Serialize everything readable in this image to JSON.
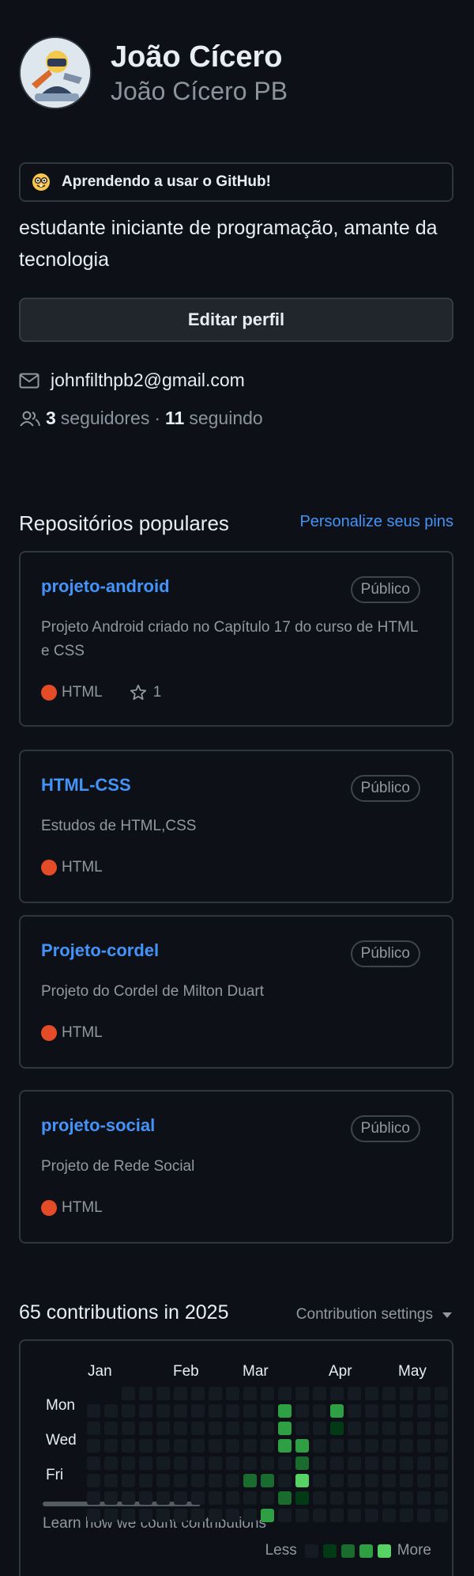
{
  "profile": {
    "name": "João Cícero",
    "login": "João Cícero PB",
    "status_text": "Aprendendo a usar o GitHub!",
    "bio": "estudante iniciante de programação, amante da tecnologia",
    "edit_button": "Editar perfil",
    "email": "johnfilthpb2@gmail.com",
    "followers_count": "3",
    "followers_label": "seguidores",
    "separator": "·",
    "following_count": "11",
    "following_label": "seguindo"
  },
  "pinned": {
    "title": "Repositórios populares",
    "customize_link": "Personalize seus pins",
    "repos": [
      {
        "name": "projeto-android",
        "visibility": "Público",
        "description": "Projeto Android criado no Capítulo 17 do curso de HTML e CSS",
        "language": "HTML",
        "stars": "1"
      },
      {
        "name": "HTML-CSS",
        "visibility": "Público",
        "description": "Estudos de HTML,CSS",
        "language": "HTML"
      },
      {
        "name": "Projeto-cordel",
        "visibility": "Público",
        "description": "Projeto do Cordel de Milton Duart",
        "language": "HTML"
      },
      {
        "name": "projeto-social",
        "visibility": "Público",
        "description": "Projeto de Rede Social",
        "language": "HTML"
      }
    ]
  },
  "contributions": {
    "title": "65 contributions in 2025",
    "settings_label": "Contribution settings",
    "months": [
      "Jan",
      "Feb",
      "Mar",
      "Apr",
      "May"
    ],
    "days": [
      "Mon",
      "Wed",
      "Fri"
    ],
    "learn_link": "Learn how we count contributions",
    "legend_less": "Less",
    "legend_more": "More",
    "colors": [
      "#151b23",
      "#033a16",
      "#196c2e",
      "#2ea043",
      "#56d364"
    ],
    "levels": [
      [
        0,
        0,
        0,
        0,
        0,
        0,
        0,
        0,
        0,
        0,
        0,
        0,
        0,
        0,
        0,
        0,
        0,
        0,
        0,
        0,
        0
      ],
      [
        0,
        0,
        0,
        0,
        0,
        0,
        0,
        0,
        0,
        0,
        0,
        3,
        0,
        0,
        3,
        0,
        0,
        0,
        0,
        0,
        0
      ],
      [
        0,
        0,
        0,
        0,
        0,
        0,
        0,
        0,
        0,
        0,
        0,
        3,
        0,
        0,
        1,
        0,
        0,
        0,
        0,
        0,
        0
      ],
      [
        0,
        0,
        0,
        0,
        0,
        0,
        0,
        0,
        0,
        0,
        0,
        3,
        3,
        0,
        0,
        0,
        0,
        0,
        0,
        0,
        0
      ],
      [
        0,
        0,
        0,
        0,
        0,
        0,
        0,
        0,
        0,
        0,
        0,
        0,
        2,
        0,
        0,
        0,
        0,
        0,
        0,
        0,
        0
      ],
      [
        0,
        0,
        0,
        0,
        0,
        0,
        0,
        0,
        0,
        2,
        2,
        0,
        4,
        0,
        0,
        0,
        0,
        0,
        0,
        0,
        0
      ],
      [
        0,
        0,
        0,
        0,
        0,
        0,
        0,
        0,
        0,
        0,
        0,
        2,
        1,
        0,
        0,
        0,
        0,
        0,
        0,
        0,
        0
      ],
      [
        0,
        0,
        0,
        0,
        0,
        0,
        0,
        0,
        0,
        0,
        3,
        0,
        0,
        0,
        0,
        0,
        0,
        0,
        0,
        0,
        0
      ]
    ]
  }
}
